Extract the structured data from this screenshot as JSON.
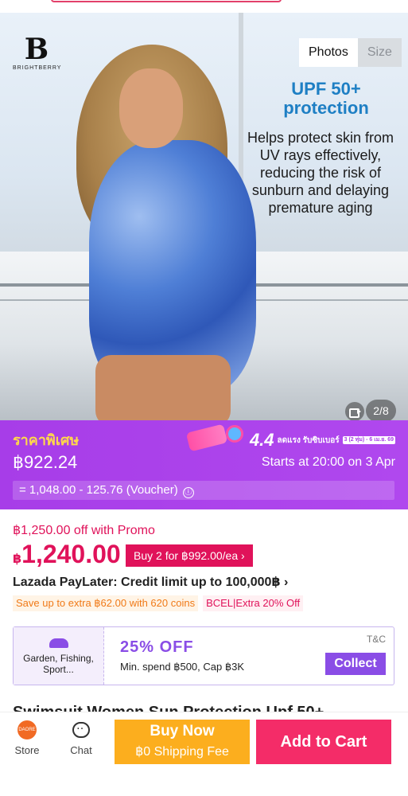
{
  "gallery": {
    "brand_name": "BRIGHTBERRY",
    "brand_mark": "B",
    "tabs": [
      "Photos",
      "Size"
    ],
    "headline": "UPF 50+ protection",
    "description": "Helps protect skin from UV rays effectively, reducing the risk of sunburn and delaying premature aging",
    "counter": "2/8",
    "icons": [
      "video-icon"
    ]
  },
  "promo": {
    "tag": "ราคาพิเศษ",
    "price": "฿922.24",
    "event_title": "4.4",
    "event_sub": "ลดแรง รับซิบเบอร์",
    "event_date": "3 (2 ทุ่ม) - 6 เม.ย. 69",
    "starts": "Starts at 20:00 on 3 Apr",
    "calc": "= 1,048.00 - 125.76 (Voucher)",
    "info_icon": "ⓘ"
  },
  "pricing": {
    "promo_off": "฿1,250.00 off with Promo",
    "currency": "฿",
    "price": "1,240.00",
    "buy2": "Buy 2 for ฿992.00/ea",
    "paylater": "Lazada PayLater: Credit limit up to 100,000฿",
    "coins": "Save up to extra ฿62.00 with 620 coins",
    "bank": "BCEL|Extra 20% Off"
  },
  "voucher": {
    "category": "Garden, Fishing, Sport...",
    "off": "25% OFF",
    "condition": "Min. spend ฿500, Cap ฿3K",
    "tc": "T&C",
    "collect": "Collect"
  },
  "product_title": "Swimsuit Women Sun Protection Upf 50+",
  "bottom": {
    "store_logo": "DAORE",
    "store": "Store",
    "chat": "Chat",
    "buy_now": "Buy Now",
    "shipping": "฿0 Shipping Fee",
    "add_to_cart": "Add to Cart"
  },
  "colors": {
    "accent_purple": "#a73de8",
    "price_pink": "#e0125a",
    "buy_orange": "#fcae1e",
    "cart_pink": "#f42c68"
  }
}
